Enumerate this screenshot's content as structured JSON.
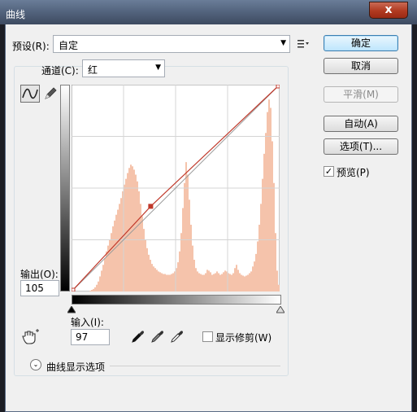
{
  "window": {
    "title": "曲线",
    "close_label": "x"
  },
  "preset": {
    "label": "预设(R):",
    "value": "自定"
  },
  "channel": {
    "label": "通道(C):",
    "value": "红"
  },
  "buttons": {
    "ok": "确定",
    "cancel": "取消",
    "smooth": "平滑(M)",
    "auto": "自动(A)",
    "options": "选项(T)..."
  },
  "preview": {
    "label": "预览(P)",
    "checked": true
  },
  "output": {
    "label": "输出(O):",
    "value": "105"
  },
  "input": {
    "label": "输入(I):",
    "value": "97"
  },
  "show_clipping": {
    "label": "显示修剪(W)",
    "checked": false
  },
  "curve_display_options": {
    "label": "曲线显示选项"
  },
  "icons": {
    "preset_menu": "preset-options-icon",
    "curve_tool": "curve-tool-icon",
    "pencil_tool": "pencil-tool-icon",
    "hand_tool": "on-image-adjust-icon",
    "eyedropper_black": "black-point-eyedropper-icon",
    "eyedropper_gray": "gray-point-eyedropper-icon",
    "eyedropper_white": "white-point-eyedropper-icon",
    "expand": "expand-chevron-icon"
  },
  "curve": {
    "points": [
      [
        0,
        0
      ],
      [
        97,
        105
      ],
      [
        255,
        255
      ]
    ],
    "control_point": {
      "input": 97,
      "output": 105
    },
    "histogram": [
      0,
      0,
      0,
      0,
      0,
      0,
      0,
      0,
      0,
      0,
      0,
      1,
      2,
      3,
      5,
      8,
      12,
      18,
      25,
      32,
      40,
      48,
      55,
      62,
      70,
      78,
      85,
      92,
      98,
      105,
      112,
      120,
      128,
      135,
      142,
      148,
      152,
      150,
      146,
      140,
      132,
      120,
      105,
      90,
      75,
      62,
      52,
      44,
      38,
      33,
      30,
      28,
      26,
      24,
      23,
      22,
      21,
      21,
      20,
      20,
      20,
      21,
      22,
      24,
      28,
      35,
      48,
      70,
      100,
      130,
      155,
      140,
      110,
      80,
      55,
      38,
      28,
      24,
      22,
      21,
      20,
      20,
      22,
      26,
      25,
      23,
      20,
      21,
      22,
      24,
      22,
      20,
      21,
      23,
      25,
      24,
      22,
      21,
      20,
      22,
      28,
      32,
      26,
      22,
      20,
      19,
      18,
      19,
      20,
      22,
      24,
      30,
      36,
      45,
      60,
      80,
      105,
      135,
      165,
      190,
      215,
      230,
      220,
      180,
      130,
      70,
      25,
      8
    ],
    "histogram_color": "#f5c3ab",
    "curve_color": "#c0392b"
  }
}
